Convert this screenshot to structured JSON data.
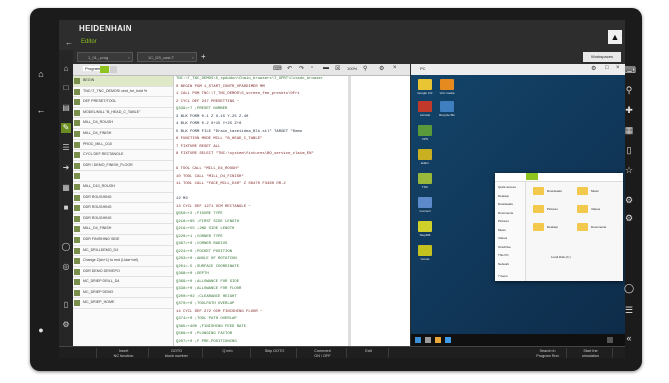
{
  "brand": "HEIDENHAIN",
  "app": {
    "back_icon": "back-arrow-icon",
    "title": "Editor"
  },
  "tabs": [
    {
      "label": "1_01_.prog"
    },
    {
      "label": "1C_DS_cast.T"
    }
  ],
  "add_tab": "+",
  "workspace_label": "Workspaces",
  "program_label": "Program",
  "zoom_label": "100%",
  "structure_items": [
    "BEGIN",
    "TNC:\\T_TNC_DEMOS\\ cent_for_hold %",
    "DEF PRESET/TOOL",
    "MODEL/MILL \"B_HEAD_C_TABLE\"",
    "MILL_D4_ROUGH",
    "MILL_D4_FINISH",
    "PROC_MILL_D10",
    "CYCL DEF RECTANGLE",
    "DDR / DEMO_FINISH_FLOOR",
    "",
    "MILL_D10_ROUGH",
    "DDR ROUGHING",
    "DDR ROUGHING",
    "DDR ROUGHING",
    "MILL_D4_FINISH",
    "DDR FINISHING SIDE",
    "MC_DRILLDEMO_D4",
    "Change Z(dx+1) to end (Lidar+ctrl)",
    "DDR DEMO DRIVEPO",
    "MC_DRIEP DRILL_D4",
    "MC_DRIEP DEMO",
    "MC_DRIEP_HOME"
  ],
  "code_lines": [
    {
      "t": "TNC:\\T_TNC_DEMOS\\5_spAddon\\Chain_browsers\\T_XPRT\\Citadn_browser",
      "k": "c"
    },
    {
      "t": "0  BEGIN PGM 1_START_CONTR_VPADDIMER MM",
      "k": "k"
    },
    {
      "t": "1  CALL PGM TNC:\\T_TNC_DEMOS\\5_screen_fee_presets\\0Fri",
      "k": "k"
    },
    {
      "t": "2  CYCL DEF 247 PRESETTING ~",
      "k": "k"
    },
    {
      "t": "     Q339=+7    ;PRESET NUMBER",
      "k": "c"
    },
    {
      "t": "3  BLK FORM 0.1 Z X-15 Y-25 Z-40",
      "k": ""
    },
    {
      "t": "4  BLK FORM 0.2 X+15 Y+25 Z+0",
      "k": ""
    },
    {
      "t": "5  BLK FORM FILE \"Drain_taxeiidea_Blk.stl\" TARGET \"Demo",
      "k": ""
    },
    {
      "t": "6  FUNCTION MODE MILL \"B_HEAD_C_TABLE\"",
      "k": "k"
    },
    {
      "t": "7  FIXTURE RESET ALL",
      "k": "k"
    },
    {
      "t": "8  FIXTURE SELECT \"TNC:\\system\\fixtures\\BO_service_claim_EN\"",
      "k": "k"
    },
    {
      "t": "",
      "k": ""
    },
    {
      "t": "9  TOOL CALL \"MILL_D4_ROUGH\"",
      "k": "k"
    },
    {
      "t": "10 TOOL CALL \"MILL_D4_FINISH\"",
      "k": "k"
    },
    {
      "t": "11 TOOL CALL \"FACE_MILL_D40\" Z S6470 F3460 DR-2",
      "k": "k"
    },
    {
      "t": "",
      "k": ""
    },
    {
      "t": "12 M3",
      "k": ""
    },
    {
      "t": "13 CYCL DEF 1271 OCM RECTANGLE ~",
      "k": "k"
    },
    {
      "t": "     Q650=+2    ;FIGURE TYPE",
      "k": "c"
    },
    {
      "t": "     Q218=+65   ;FIRST SIDE LENGTH",
      "k": "c"
    },
    {
      "t": "     Q219=+55   ;2ND SIDE LENGTH",
      "k": "c"
    },
    {
      "t": "     Q220=+1    ;CORNER TYPE",
      "k": "c"
    },
    {
      "t": "     Q367=+0    ;CORNER RADIUS",
      "k": "c"
    },
    {
      "t": "     Q224=+0    ;POCKET POSITION",
      "k": "c"
    },
    {
      "t": "     Q203=+0    ;ANGLE OF ROTATION",
      "k": "c"
    },
    {
      "t": "     Q201=-5    ;SURFACE COORDINATE",
      "k": "c"
    },
    {
      "t": "     Q368=+0    ;DEPTH",
      "k": "c"
    },
    {
      "t": "     Q369=+0    ;ALLOWANCE FOR SIDE",
      "k": "c"
    },
    {
      "t": "     Q338=+0    ;ALLOWANCE FOR FLOOR",
      "k": "c"
    },
    {
      "t": "     Q200=+02   ;CLEARANCE HEIGHT",
      "k": "c"
    },
    {
      "t": "     Q370=+0    ;TOOLPATH OVERLAP",
      "k": "c"
    },
    {
      "t": "14 CYCL DEF 272 OCM FINISHING FLOOR ~",
      "k": "k"
    },
    {
      "t": "     Q374=+0    ;TOOL PATH OVERLAP",
      "k": "c"
    },
    {
      "t": "     Q385=+400  ;FINISHING FEED RATE",
      "k": "c"
    },
    {
      "t": "     Q569=+0    ;PLUNGING FACTOR",
      "k": "c"
    },
    {
      "t": "     Q207=+0    ;F PRE-POSITIONING",
      "k": "c"
    }
  ],
  "remote": {
    "title": "PC",
    "desktop_icons": [
      {
        "label": "Google Chr",
        "color": "#e9c433"
      },
      {
        "label": "VLC media",
        "color": "#e58a1f"
      },
      {
        "label": "Acrobat",
        "color": "#c0392b"
      },
      {
        "label": "Recycle Bin",
        "color": "#3f7fbf"
      },
      {
        "label": "VPN",
        "color": "#5a9a3a"
      },
      {
        "label": "Editor",
        "color": "#c8b021"
      },
      {
        "label": "TNC",
        "color": "#9ab83a"
      },
      {
        "label": "Connect",
        "color": "#5c8acb"
      },
      {
        "label": "StepMill",
        "color": "#cfd12a"
      },
      {
        "label": "Gcode",
        "color": "#c4c21e"
      }
    ],
    "explorer": {
      "nav": [
        "Quick access",
        "Desktop",
        "Downloads",
        "Documents",
        "Pictures",
        "Music",
        "Videos",
        "OneDrive",
        "This PC",
        "Network"
      ],
      "folders": [
        "Downloads",
        "Music",
        "Pictures",
        "Videos",
        "Desktop",
        "Documents"
      ],
      "drive": "Local Disk (C:)",
      "status": "7 items"
    }
  },
  "softkeys": [
    {
      "l1": "",
      "l2": ""
    },
    {
      "l1": "Insert",
      "l2": "NC function"
    },
    {
      "l1": "GOTO",
      "l2": "block number"
    },
    {
      "l1": "",
      "l2": "Q info"
    },
    {
      "l1": "",
      "l2": "Skip GOTO"
    },
    {
      "l1": "Comment",
      "l2": "ON / OFF"
    },
    {
      "l1": "",
      "l2": "Edit"
    },
    {
      "l1": "Search in",
      "l2": "Program Run"
    },
    {
      "l1": "Start the",
      "l2": "simulation"
    }
  ]
}
